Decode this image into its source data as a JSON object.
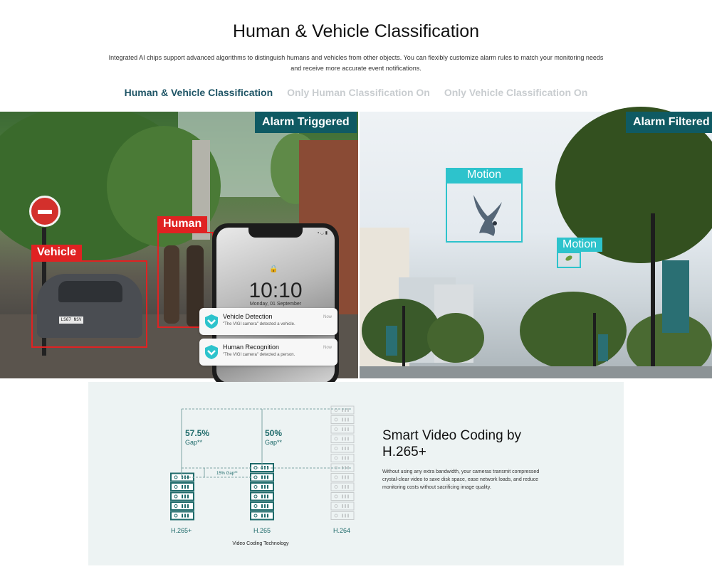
{
  "header": {
    "title": "Human & Vehicle Classification",
    "description": "Integrated AI chips support advanced algorithms to distinguish humans and vehicles from other objects. You can flexibly customize alarm rules to match your monitoring needs and receive more accurate event notifications."
  },
  "tabs": [
    {
      "label": "Human & Vehicle Classification",
      "active": true
    },
    {
      "label": "Only Human Classification On",
      "active": false
    },
    {
      "label": "Only Vehicle Classification On",
      "active": false
    }
  ],
  "left_panel": {
    "badge": "Alarm Triggered",
    "detections": [
      "Vehicle",
      "Human"
    ],
    "plate": "LS67 NSV",
    "phone": {
      "time": "10:10",
      "date": "Monday, 01 September",
      "notifications": [
        {
          "title": "Vehicle Detection",
          "text": "\"The VIGI camera\" detected a vehicle.",
          "time": "Now"
        },
        {
          "title": "Human Recognition",
          "text": "\"The VIGI camera\" detected a person.",
          "time": "Now"
        }
      ]
    }
  },
  "right_panel": {
    "badge": "Alarm Filtered",
    "detections": [
      "Motion",
      "Motion"
    ]
  },
  "coding": {
    "title": "Smart Video Coding by H.265+",
    "description": "Without using any extra bandwidth, your cameras transmit compressed crystal-clear video to save disk space, ease network loads, and reduce monitoring costs without sacrificing image quality.",
    "xlabel": "Video Coding Technology",
    "gap_unit": "Gap**",
    "small_gap": "15% Gap**"
  },
  "colors": {
    "accent": "#1f5566",
    "badge": "#0f5a63",
    "alarm_red": "#e02222",
    "motion_cyan": "#2dc3cc",
    "server": "#1e6a6a",
    "server_faded": "#c7cbcc"
  },
  "chart_data": {
    "type": "bar",
    "categories": [
      "H.265+",
      "H.265",
      "H.264"
    ],
    "values": [
      5,
      6,
      12
    ],
    "xlabel": "Video Coding Technology",
    "annotations": [
      {
        "between": [
          "H.265+",
          "H.264"
        ],
        "value": "57.5%",
        "unit": "Gap**"
      },
      {
        "between": [
          "H.265",
          "H.264"
        ],
        "value": "50%",
        "unit": "Gap**"
      },
      {
        "between": [
          "H.265+",
          "H.265"
        ],
        "value": "15% Gap**"
      }
    ]
  }
}
